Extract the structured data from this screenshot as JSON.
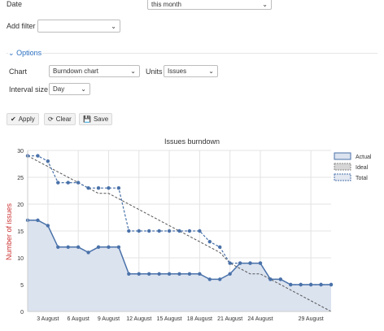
{
  "filters": {
    "date_label": "Date",
    "date_value": "this month",
    "add_filter_label": "Add filter",
    "add_filter_value": ""
  },
  "options": {
    "legend": "Options",
    "chart_label": "Chart",
    "chart_value": "Burndown chart",
    "units_label": "Units",
    "units_value": "Issues",
    "interval_label": "Interval size",
    "interval_value": "Day"
  },
  "actions": {
    "apply": "Apply",
    "clear": "Clear",
    "save": "Save"
  },
  "colors": {
    "actual_line": "#4a72aa",
    "actual_fill": "#dbe3ef",
    "ideal_line": "#555555",
    "total_line": "#4a72aa",
    "ylabel": "#cc3333",
    "link": "#2a6ebf"
  },
  "chart_data": {
    "type": "line",
    "title": "Issues burndown",
    "xlabel": "",
    "ylabel": "Number of issues",
    "ylim": [
      0,
      30
    ],
    "yticks": [
      0,
      5,
      10,
      15,
      20,
      25,
      30
    ],
    "x_day_range": [
      1,
      29
    ],
    "xtick_days": [
      3,
      6,
      9,
      12,
      15,
      18,
      21,
      24,
      29
    ],
    "xtick_labels": [
      "3 August",
      "6 August",
      "9 August",
      "12 August",
      "15 August",
      "18 August",
      "21 August",
      "24 August",
      "29 August"
    ],
    "grid": true,
    "legend_position": "top-right",
    "series": [
      {
        "name": "Actual",
        "style": "solid-area",
        "points": [
          [
            1,
            17
          ],
          [
            2,
            17
          ],
          [
            3,
            16
          ],
          [
            4,
            12
          ],
          [
            5,
            12
          ],
          [
            6,
            12
          ],
          [
            7,
            11
          ],
          [
            8,
            12
          ],
          [
            9,
            12
          ],
          [
            10,
            12
          ],
          [
            11,
            7
          ],
          [
            12,
            7
          ],
          [
            13,
            7
          ],
          [
            14,
            7
          ],
          [
            15,
            7
          ],
          [
            16,
            7
          ],
          [
            17,
            7
          ],
          [
            18,
            7
          ],
          [
            19,
            6
          ],
          [
            20,
            6
          ],
          [
            21,
            7
          ],
          [
            22,
            9
          ],
          [
            23,
            9
          ],
          [
            24,
            9
          ],
          [
            25,
            6
          ],
          [
            26,
            6
          ],
          [
            27,
            5
          ],
          [
            28,
            5
          ],
          [
            29,
            5
          ],
          [
            30,
            5
          ],
          [
            31,
            5
          ]
        ]
      },
      {
        "name": "Ideal",
        "style": "dashed",
        "points": [
          [
            1,
            29
          ],
          [
            2,
            28
          ],
          [
            3,
            27
          ],
          [
            4,
            26
          ],
          [
            5,
            25
          ],
          [
            6,
            24
          ],
          [
            7,
            23
          ],
          [
            8,
            22
          ],
          [
            9,
            22
          ],
          [
            10,
            21
          ],
          [
            11,
            20
          ],
          [
            12,
            19
          ],
          [
            13,
            18
          ],
          [
            14,
            17
          ],
          [
            15,
            16
          ],
          [
            16,
            15
          ],
          [
            17,
            14
          ],
          [
            18,
            13
          ],
          [
            19,
            12
          ],
          [
            20,
            11
          ],
          [
            21,
            9
          ],
          [
            22,
            8
          ],
          [
            23,
            7
          ],
          [
            24,
            7
          ],
          [
            25,
            6
          ],
          [
            26,
            5
          ],
          [
            27,
            4
          ],
          [
            28,
            3
          ],
          [
            29,
            2
          ],
          [
            30,
            1
          ],
          [
            31,
            0
          ]
        ]
      },
      {
        "name": "Total",
        "style": "dashed-markers",
        "points": [
          [
            1,
            29
          ],
          [
            2,
            29
          ],
          [
            3,
            28
          ],
          [
            4,
            24
          ],
          [
            5,
            24
          ],
          [
            6,
            24
          ],
          [
            7,
            23
          ],
          [
            8,
            23
          ],
          [
            9,
            23
          ],
          [
            10,
            23
          ],
          [
            11,
            15
          ],
          [
            12,
            15
          ],
          [
            13,
            15
          ],
          [
            14,
            15
          ],
          [
            15,
            15
          ],
          [
            16,
            15
          ],
          [
            17,
            15
          ],
          [
            18,
            15
          ],
          [
            19,
            13
          ],
          [
            20,
            12
          ],
          [
            21,
            9
          ],
          [
            22,
            9
          ],
          [
            23,
            9
          ],
          [
            24,
            9
          ],
          [
            25,
            6
          ],
          [
            26,
            6
          ],
          [
            27,
            5
          ],
          [
            28,
            5
          ],
          [
            29,
            5
          ],
          [
            30,
            5
          ],
          [
            31,
            5
          ]
        ]
      }
    ]
  }
}
